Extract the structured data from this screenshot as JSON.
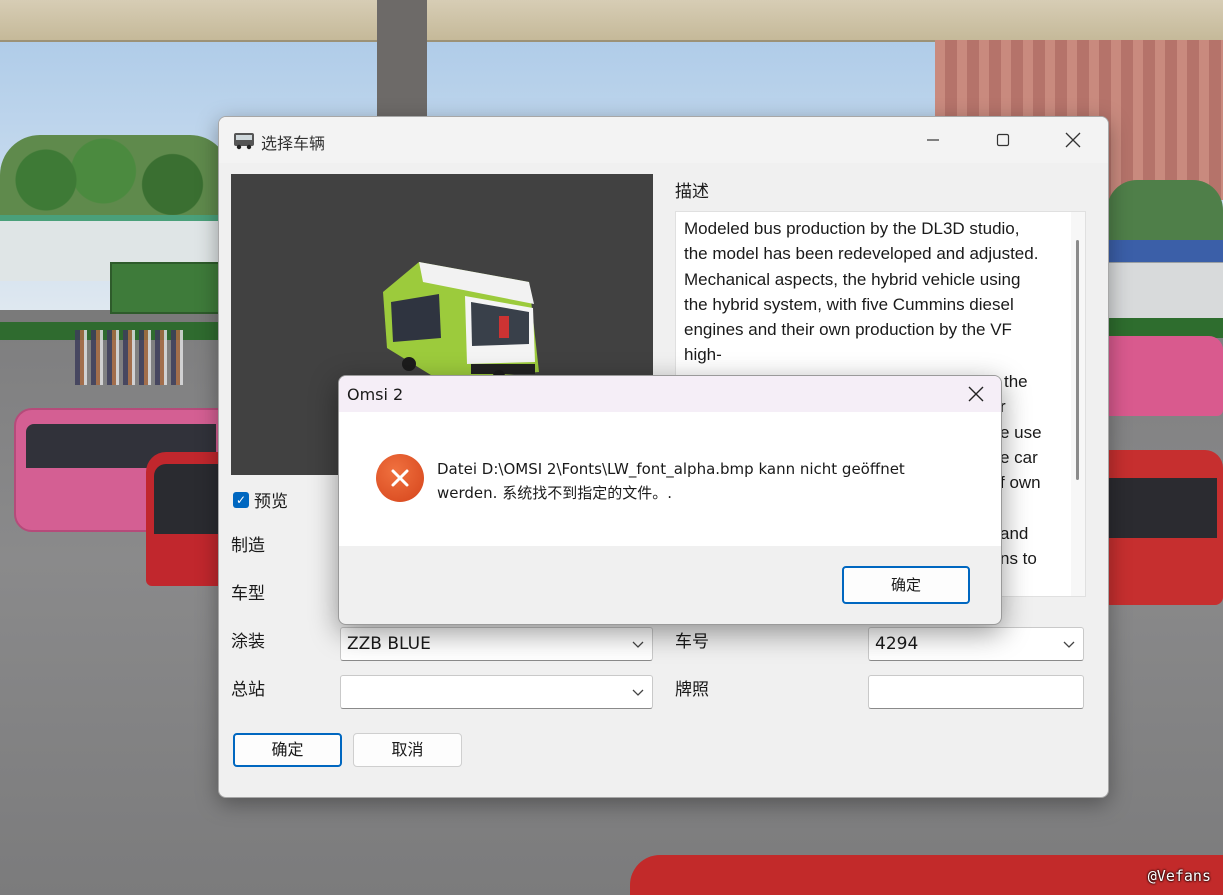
{
  "watermark": "@Vefans",
  "main_window": {
    "title": "选择车辆",
    "preview_checkbox_label": "预览",
    "preview_checked": true,
    "description_label": "描述",
    "description_text": "Modeled bus production by the DL3D studio, the model has been redeveloped and adjusted. Mechanical aspects, the hybrid vehicle using the hybrid system, with five Cummins diesel engines and their own production by the VF high-",
    "desc_fragments": [
      "the",
      "r",
      "e use",
      "e car",
      "f own",
      "and",
      "ns to"
    ],
    "fields": {
      "manufacturer_label": "制造",
      "model_label": "车型",
      "livery_label": "涂装",
      "livery_value": "ZZB BLUE",
      "depot_label": "总站",
      "depot_value": "",
      "number_label": "车号",
      "number_value": "4294",
      "plate_label": "牌照",
      "plate_value": ""
    },
    "ok_label": "确定",
    "cancel_label": "取消"
  },
  "error_dialog": {
    "title": "Omsi 2",
    "message_line1": "Datei D:\\OMSI 2\\Fonts\\LW_font_alpha.bmp kann nicht geöffnet",
    "message_line2": "werden. 系统找不到指定的文件。.",
    "ok_label": "确定"
  },
  "colors": {
    "accent": "#0067c0",
    "error_icon": "#e0582b"
  }
}
